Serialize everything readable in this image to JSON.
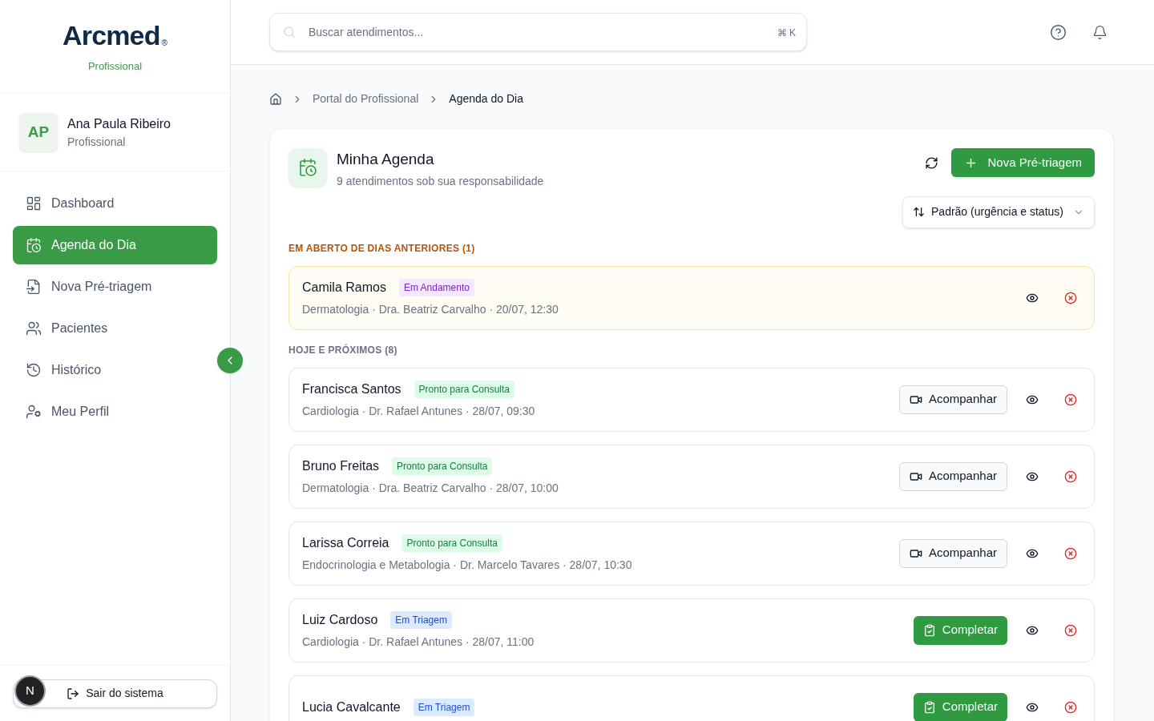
{
  "brand": {
    "logo": "Arcmed",
    "registered": "®",
    "subtitle": "Profissional"
  },
  "user": {
    "initials": "AP",
    "name": "Ana Paula Ribeiro",
    "role": "Profissional"
  },
  "nav": [
    {
      "label": "Dashboard",
      "selected": false
    },
    {
      "label": "Agenda do Dia",
      "selected": true
    },
    {
      "label": "Nova Pré-triagem",
      "selected": false
    },
    {
      "label": "Pacientes",
      "selected": false
    },
    {
      "label": "Histórico",
      "selected": false
    },
    {
      "label": "Meu Perfil",
      "selected": false
    }
  ],
  "logout": "Sair do sistema",
  "dev_badge": "N",
  "search": {
    "placeholder": "Buscar atendimentos...",
    "shortcut": "⌘ K"
  },
  "breadcrumb": [
    "Portal do Profissional",
    "Agenda do Dia"
  ],
  "page": {
    "title": "Minha Agenda",
    "subtitle": "9 atendimentos sob sua responsabilidade",
    "new_button": "Nova Pré-triagem",
    "sort": "Padrão (urgência e status)"
  },
  "sections": [
    {
      "kind": "overdue",
      "title": "EM ABERTO DE DIAS ANTERIORES (1)",
      "items": [
        {
          "name": "Camila Ramos",
          "status": "Em Andamento",
          "color": "#7e22ce",
          "details": "Dermatologia · Dra. Beatriz Carvalho · 20/07, 12:30"
        }
      ]
    },
    {
      "kind": "upcoming",
      "title": "HOJE E PRÓXIMOS (8)",
      "items": [
        {
          "name": "Francisca Santos",
          "status": "Pronto para Consulta",
          "color": "#15803d",
          "details": "Cardiologia · Dr. Rafael Antunes · 28/07, 09:30",
          "action": {
            "kind": "follow",
            "label": "Acompanhar"
          }
        },
        {
          "name": "Bruno Freitas",
          "status": "Pronto para Consulta",
          "color": "#15803d",
          "details": "Dermatologia · Dra. Beatriz Carvalho · 28/07, 10:00",
          "action": {
            "kind": "follow",
            "label": "Acompanhar"
          }
        },
        {
          "name": "Larissa Correia",
          "status": "Pronto para Consulta",
          "color": "#15803d",
          "details": "Endocrinologia e Metabologia · Dr. Marcelo Tavares · 28/07, 10:30",
          "action": {
            "kind": "follow",
            "label": "Acompanhar"
          }
        },
        {
          "name": "Luiz Cardoso",
          "status": "Em Triagem",
          "color": "#1d4ed8",
          "details": "Cardiologia · Dr. Rafael Antunes · 28/07, 11:00",
          "action": {
            "kind": "complete",
            "label": "Completar"
          }
        },
        {
          "name": "Lucia Cavalcante",
          "status": "Em Triagem",
          "color": "#1d4ed8",
          "action": {
            "kind": "complete",
            "label": "Completar"
          }
        }
      ]
    }
  ]
}
